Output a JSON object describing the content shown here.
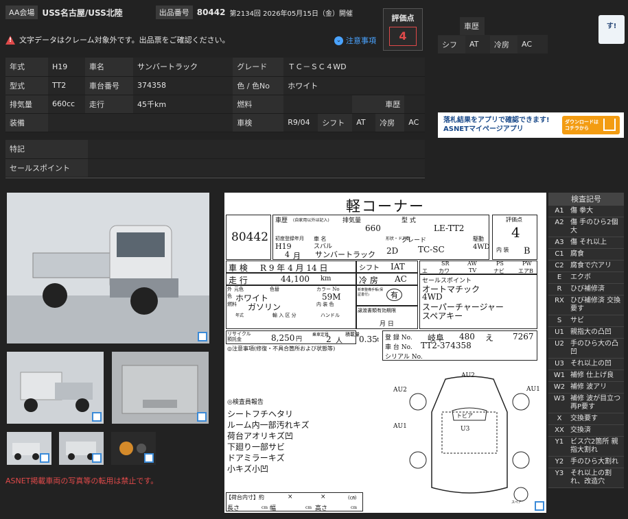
{
  "header": {
    "venue_tag": "AA会場",
    "venue": "USS名古屋/USS北陸",
    "lot_tag": "出品番号",
    "lot_number": "80442",
    "session": "第2134回 2026年05月15日（金）開催"
  },
  "warning": {
    "text": "文字データはクレーム対象外です。出品票をご確認ください。",
    "notice_label": "注意事項"
  },
  "score": {
    "label": "評価点",
    "value": "4"
  },
  "spec": {
    "year_k": "年式",
    "year_v": "H19",
    "name_k": "車名",
    "name_v": "サンバートラック",
    "grade_k": "グレード",
    "grade_v": "ＴＣ－ＳＣ４WD",
    "model_k": "型式",
    "model_v": "TT2",
    "chassis_k": "車台番号",
    "chassis_v": "374358",
    "color_k": "色 / 色No",
    "color_v": "ホワイト",
    "disp_k": "排気量",
    "disp_v": "660cc",
    "mileage_k": "走行",
    "mileage_v": "45千km",
    "fuel_k": "燃料",
    "fuel_v": "",
    "history_k": "車歴",
    "history_v": "",
    "equip_k": "装備",
    "equip_v": "",
    "inspect_k": "車検",
    "inspect_v": "R9/04",
    "shift_k": "シフト",
    "shift_v": "AT",
    "ac_k": "冷房",
    "ac_v": "AC",
    "notes_k": "特記",
    "notes_v": "",
    "sales_k": "セールスポイント",
    "sales_v": ""
  },
  "right_panel": {
    "history_k": "車歴",
    "shift_k": "シフ",
    "shift_v": "AT",
    "ac_k": "冷房",
    "ac_v": "AC"
  },
  "chat": {
    "text": "す!"
  },
  "ad": {
    "line1": "落札結果をアプリで確認できます!",
    "line2": "ASNETマイページアプリ",
    "button": "ダウンロードは コチラから"
  },
  "footer": {
    "text": "ASNET掲載車両の写真等の転用は禁止です。"
  },
  "sheet": {
    "title": "軽コーナー",
    "lot": "80442",
    "history": "車歴",
    "history_note": "(自家用以外は記入)",
    "disp_k": "排気量",
    "disp_v": "660",
    "model_k": "型 式",
    "model_v": "LE-TT2",
    "score_k": "評価点",
    "score_v": "4",
    "interior_k": "内 装",
    "interior_v": "B",
    "reg_k": "初度登録年月",
    "reg_year": "H19",
    "reg_month": "4",
    "reg_month_unit": "月",
    "name_k": "車 名",
    "maker": "スバル",
    "name_v": "サンバートラック",
    "doors_k": "形状・ドア数",
    "doors_v": "2D",
    "grade_k": "グレード",
    "grade_v": "TC-SC",
    "drive_k": "駆動",
    "drive_v": "4WD",
    "inspect_k": "車 検",
    "inspect_v": "R 9 年 4 月 14 日",
    "shift_k": "シフト",
    "shift_v": "IAT",
    "eq1": [
      "SR",
      "AW",
      "PS",
      "PW"
    ],
    "eq2": [
      "カワ",
      "TV",
      "ナビ",
      "エアB"
    ],
    "eq2_1": "エ",
    "mileage_k": "走 行",
    "mileage_v": "44,100",
    "mileage_unit": "km",
    "ac_k": "冷 房",
    "ac_v": "AC",
    "sales_k": "セールスポイント",
    "sales_lines": [
      "オートマチック",
      "4WD",
      "スーパーチャージャー",
      "スペアキー"
    ],
    "color_k1": "外 色",
    "color_orig": "元色",
    "color_changed": "色替",
    "color_v": "ホワイト",
    "color_no_k": "カラー No",
    "color_no_v": "59M",
    "interior_color_k": "内 装 色",
    "manual_k": "新車整備手帳(保証書付)",
    "manual_v": "有",
    "transfer_k": "譲渡書類有効期限",
    "transfer_unit": "月 日",
    "fuel_k": "燃料",
    "fuel_v": "ガソリン",
    "import_k": "輸 入 区 分",
    "handle_k": "ハンドル",
    "year_k": "年式",
    "recycle_k": "リサイクル預託金",
    "recycle_v": "8,250",
    "recycle_unit": "円",
    "capacity_k": "乗車定員",
    "capacity_v": "2",
    "capacity_unit": "人",
    "load_k": "積載量",
    "load_v": "0.35",
    "load_unit": "t",
    "reg_no_k": "登 録 No.",
    "reg_no_v": [
      "岐阜",
      "480",
      "え",
      "7267"
    ],
    "chassis_k": "車 台 No.",
    "chassis_v": "TT2-374358",
    "serial_k": "シリアル No.",
    "caution_k": "◎注意事項(修復・不具合箇所および状態等)",
    "inspector_k": "◎検査員報告",
    "inspector_lines": [
      "シートフチヘタリ",
      "ルーム内一部汚れキズ",
      "荷台アオリキズ凹",
      "下廻り一部サビ",
      "ドアミラーキズ",
      "小キズ小凹"
    ],
    "diagram_labels": {
      "au2_top": "AU2",
      "au2_left": "AU2",
      "au1_left": "AU1",
      "au1_right": "AU1",
      "u3": "U3",
      "tobia": "トビア",
      "spare": "スペア"
    },
    "cargo_k": "【荷台内寸】約",
    "cargo_x": "×",
    "cargo_unit": "(㎝)",
    "len_k": "長さ",
    "width_k": "幅",
    "height_k": "高さ",
    "cm": "cm"
  },
  "legend": {
    "title": "検査記号",
    "items": [
      {
        "code": "A1",
        "desc": "傷 拳大"
      },
      {
        "code": "A2",
        "desc": "傷 手のひら2個大"
      },
      {
        "code": "A3",
        "desc": "傷 それ以上"
      },
      {
        "code": "C1",
        "desc": "腐食"
      },
      {
        "code": "C2",
        "desc": "腐食で穴アリ"
      },
      {
        "code": "E",
        "desc": "エクボ"
      },
      {
        "code": "R",
        "desc": "ひび補修済"
      },
      {
        "code": "RX",
        "desc": "ひび補修済 交換要す"
      },
      {
        "code": "S",
        "desc": "サビ"
      },
      {
        "code": "U1",
        "desc": "親指大の凸凹"
      },
      {
        "code": "U2",
        "desc": "手のひら大の凸凹"
      },
      {
        "code": "U3",
        "desc": "それ以上の凹"
      },
      {
        "code": "W1",
        "desc": "補修 仕上げ良"
      },
      {
        "code": "W2",
        "desc": "補修 波アリ"
      },
      {
        "code": "W3",
        "desc": "補修 波が目立つ 再P要す"
      },
      {
        "code": "X",
        "desc": "交換要す"
      },
      {
        "code": "XX",
        "desc": "交換済"
      },
      {
        "code": "Y1",
        "desc": "ビス穴2箇所 親指大割れ"
      },
      {
        "code": "Y2",
        "desc": "手のひら大割れ"
      },
      {
        "code": "Y3",
        "desc": "それ以上の割れ、改造穴"
      }
    ]
  },
  "icons": {
    "warning": "warning-icon",
    "notice": "chevron-down-icon",
    "expand": "expand-icon",
    "download": "download-icon"
  }
}
